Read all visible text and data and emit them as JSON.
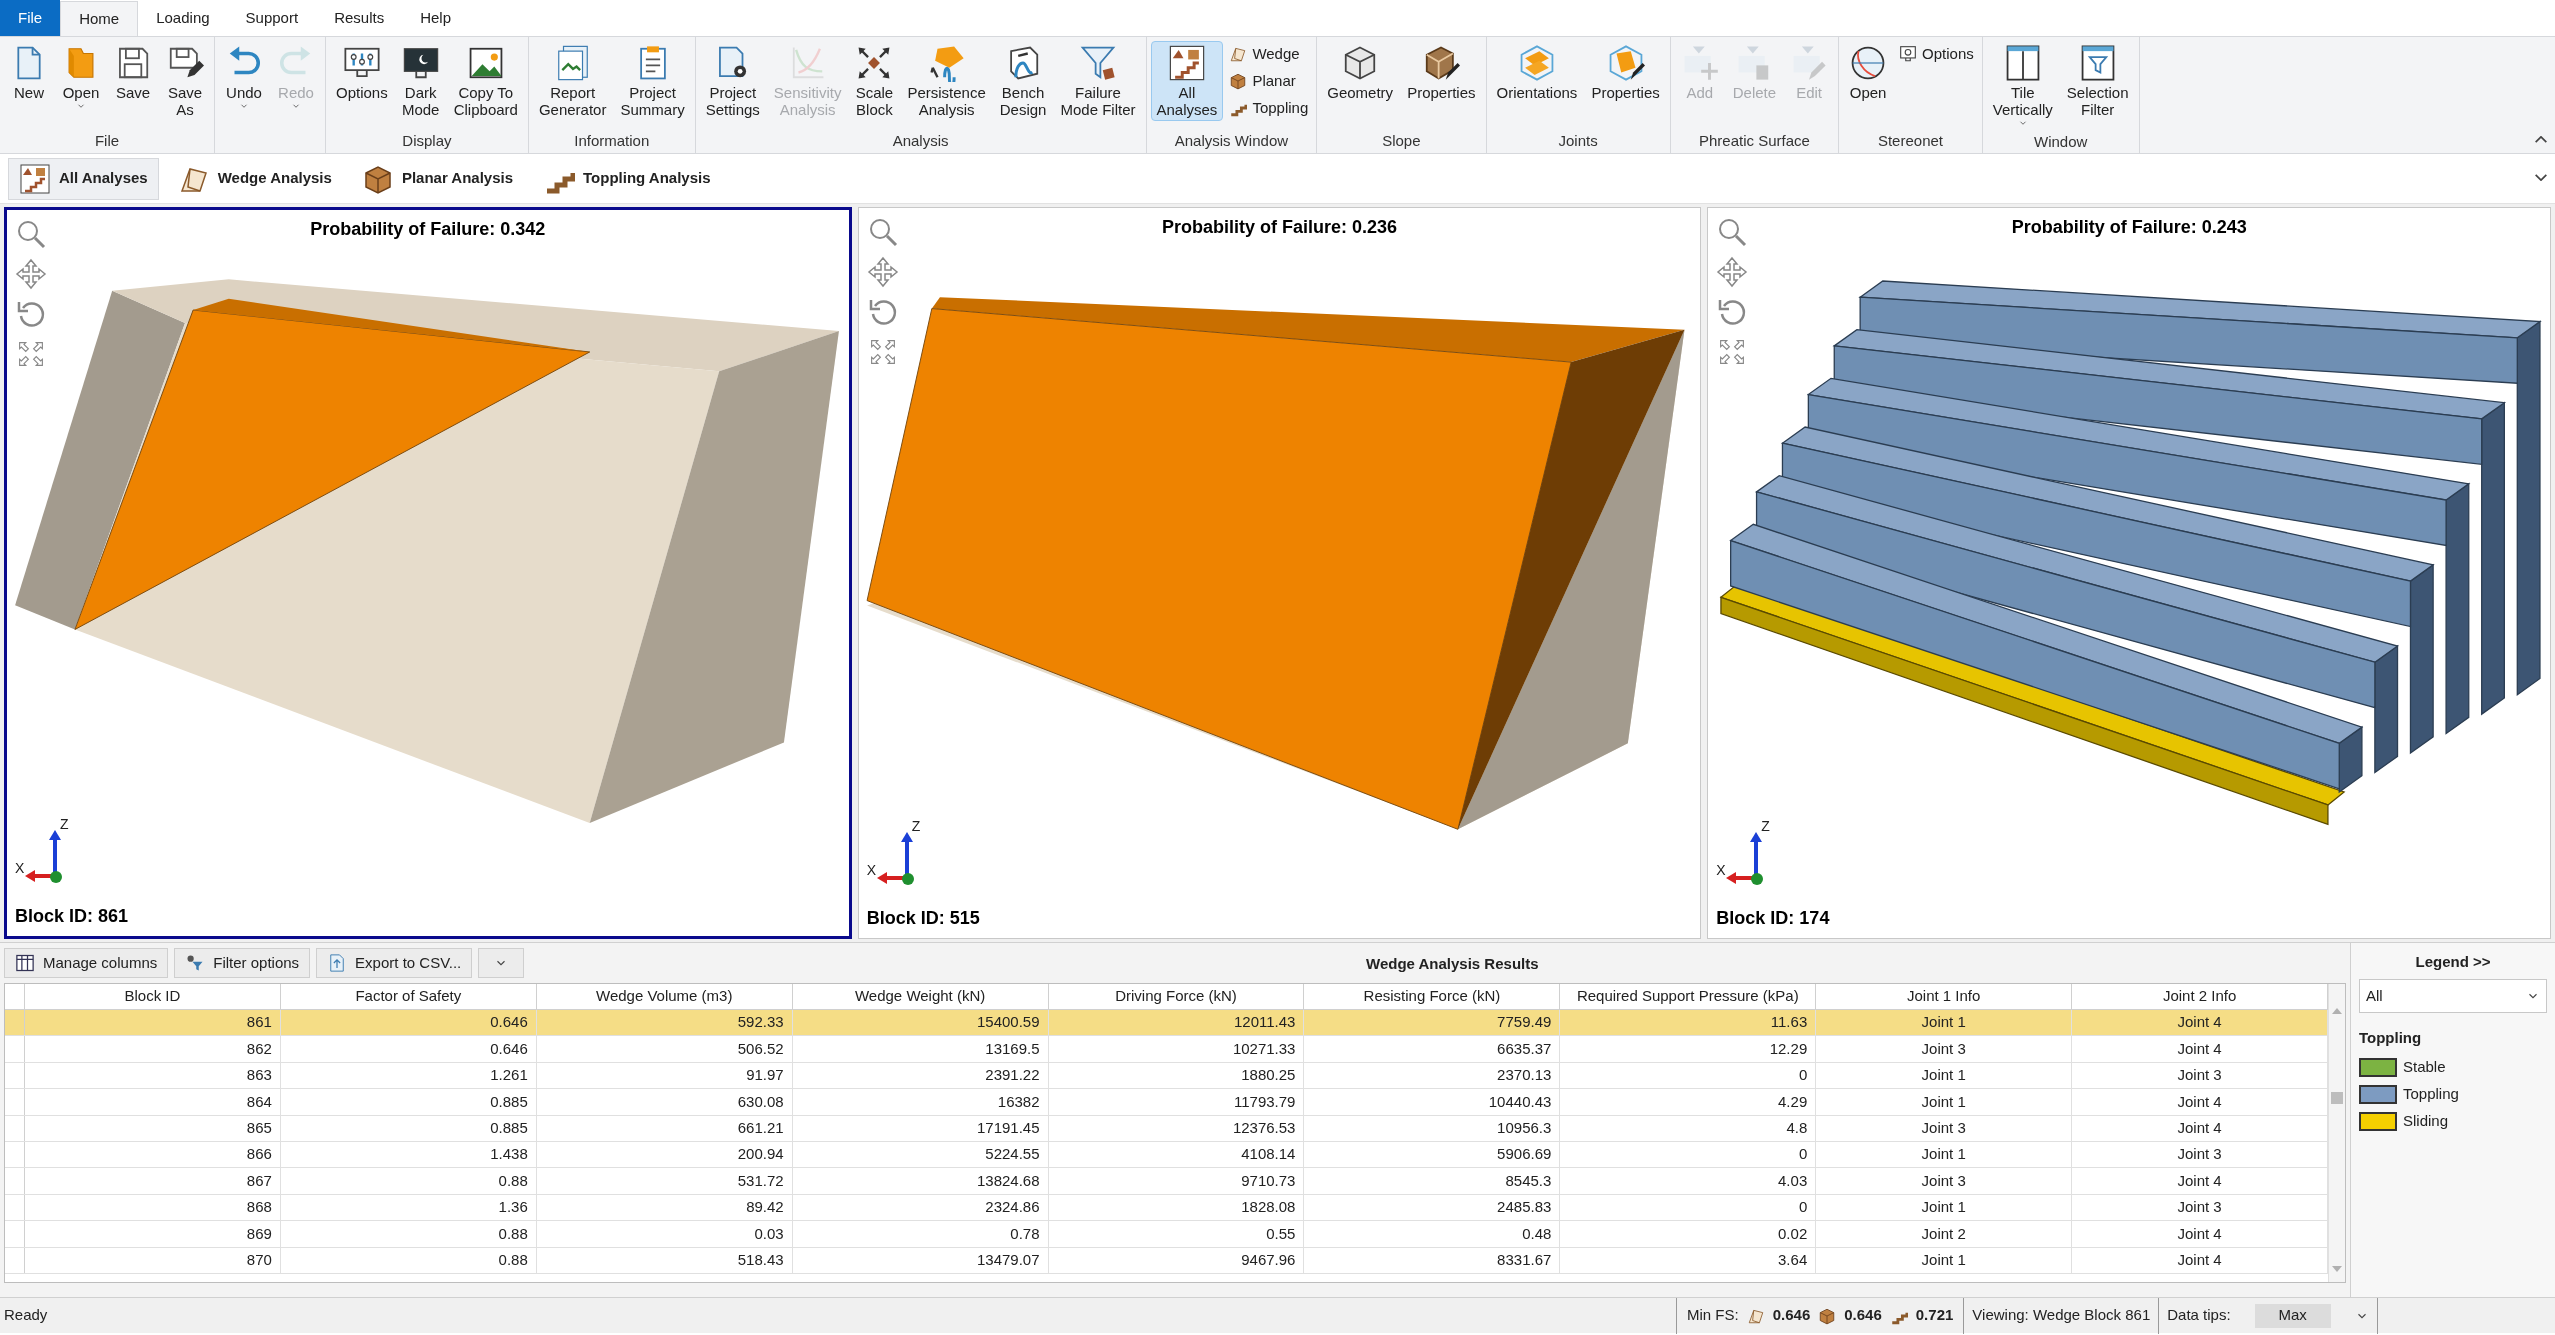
{
  "menu_tabs": [
    {
      "label": "File",
      "selected": false,
      "kind": "file"
    },
    {
      "label": "Home",
      "selected": true,
      "kind": "tab"
    },
    {
      "label": "Loading",
      "selected": false,
      "kind": "tab"
    },
    {
      "label": "Support",
      "selected": false,
      "kind": "tab"
    },
    {
      "label": "Results",
      "selected": false,
      "kind": "tab"
    },
    {
      "label": "Help",
      "selected": false,
      "kind": "tab"
    }
  ],
  "ribbon": [
    {
      "label": "File",
      "items": [
        {
          "label": "New",
          "kind": "large",
          "disabled": false,
          "dropdown": false,
          "selected": false
        },
        {
          "label": "Open",
          "kind": "large",
          "disabled": false,
          "dropdown": true,
          "selected": false
        },
        {
          "label": "Save",
          "kind": "large",
          "disabled": false,
          "dropdown": false,
          "selected": false
        },
        {
          "label": "Save\nAs",
          "kind": "large",
          "disabled": false,
          "dropdown": false,
          "selected": false
        }
      ]
    },
    {
      "items": [
        {
          "label": "Undo",
          "kind": "large",
          "disabled": false,
          "dropdown": true,
          "selected": false
        },
        {
          "label": "Redo",
          "kind": "large",
          "disabled": true,
          "dropdown": true,
          "selected": false
        }
      ]
    },
    {
      "label": "Display",
      "items": [
        {
          "label": "Options",
          "kind": "large",
          "disabled": false,
          "dropdown": false,
          "selected": false
        },
        {
          "label": "Dark\nMode",
          "kind": "large",
          "disabled": false,
          "dropdown": false,
          "selected": false
        },
        {
          "label": "Copy To\nClipboard",
          "kind": "large",
          "disabled": false,
          "dropdown": false,
          "selected": false
        }
      ]
    },
    {
      "label": "Information",
      "items": [
        {
          "label": "Report\nGenerator",
          "kind": "large",
          "disabled": false,
          "dropdown": false,
          "selected": false
        },
        {
          "label": "Project\nSummary",
          "kind": "large",
          "disabled": false,
          "dropdown": false,
          "selected": false
        }
      ]
    },
    {
      "label": "Analysis",
      "items": [
        {
          "label": "Project\nSettings",
          "kind": "large",
          "disabled": false,
          "dropdown": false,
          "selected": false
        },
        {
          "label": "Sensitivity\nAnalysis",
          "kind": "large",
          "disabled": true,
          "dropdown": false,
          "selected": false
        },
        {
          "label": "Scale\nBlock",
          "kind": "large",
          "disabled": false,
          "dropdown": false,
          "selected": false
        },
        {
          "label": "Persistence\nAnalysis",
          "kind": "large",
          "disabled": false,
          "dropdown": false,
          "selected": false
        },
        {
          "label": "Bench\nDesign",
          "kind": "large",
          "disabled": false,
          "dropdown": false,
          "selected": false
        },
        {
          "label": "Failure\nMode Filter",
          "kind": "large",
          "disabled": false,
          "dropdown": false,
          "selected": false
        }
      ]
    },
    {
      "label": "Analysis Window",
      "items": [
        {
          "label": "All\nAnalyses",
          "kind": "large",
          "disabled": false,
          "dropdown": false,
          "selected": true
        },
        {
          "label": "Wedge",
          "kind": "small",
          "disabled": false,
          "dropdown": false,
          "selected": false
        },
        {
          "label": "Planar",
          "kind": "small",
          "disabled": false,
          "dropdown": false,
          "selected": false
        },
        {
          "label": "Toppling",
          "kind": "small",
          "disabled": false,
          "dropdown": false,
          "selected": false
        }
      ]
    },
    {
      "label": "Slope",
      "items": [
        {
          "label": "Geometry",
          "kind": "large",
          "disabled": false,
          "dropdown": false,
          "selected": false
        },
        {
          "label": "Properties",
          "kind": "large",
          "disabled": false,
          "dropdown": false,
          "selected": false
        }
      ]
    },
    {
      "label": "Joints",
      "items": [
        {
          "label": "Orientations",
          "kind": "large",
          "disabled": false,
          "dropdown": false,
          "selected": false
        },
        {
          "label": "Properties",
          "kind": "large",
          "disabled": false,
          "dropdown": false,
          "selected": false
        }
      ]
    },
    {
      "label": "Phreatic Surface",
      "items": [
        {
          "label": "Add",
          "kind": "large",
          "disabled": true,
          "dropdown": false,
          "selected": false
        },
        {
          "label": "Delete",
          "kind": "large",
          "disabled": true,
          "dropdown": false,
          "selected": false
        },
        {
          "label": "Edit",
          "kind": "large",
          "disabled": true,
          "dropdown": false,
          "selected": false
        }
      ]
    },
    {
      "label": "Stereonet",
      "items": [
        {
          "label": "Open",
          "kind": "large",
          "disabled": false,
          "dropdown": false,
          "selected": false
        },
        {
          "label": "Options",
          "kind": "small",
          "disabled": false,
          "dropdown": false,
          "selected": false
        }
      ]
    },
    {
      "label": "Window",
      "items": [
        {
          "label": "Tile\nVertically",
          "kind": "large",
          "disabled": false,
          "dropdown": true,
          "selected": false
        },
        {
          "label": "Selection\nFilter",
          "kind": "large",
          "disabled": false,
          "dropdown": false,
          "selected": false
        }
      ]
    }
  ],
  "analysis_tabs": [
    {
      "label": "All Analyses",
      "selected": true
    },
    {
      "label": "Wedge Analysis",
      "selected": false
    },
    {
      "label": "Planar Analysis",
      "selected": false
    },
    {
      "label": "Toppling Analysis",
      "selected": false
    }
  ],
  "viewports": [
    {
      "kind": "wedge",
      "title": "Probability of Failure: 0.342",
      "block_id": "Block ID: 861",
      "selected": true,
      "axis_labels": [
        "Z",
        "X"
      ]
    },
    {
      "kind": "planar",
      "title": "Probability of Failure: 0.236",
      "block_id": "Block ID: 515",
      "selected": false,
      "axis_labels": [
        "Z",
        "X"
      ]
    },
    {
      "kind": "toppling",
      "title": "Probability of Failure: 0.243",
      "block_id": "Block ID: 174",
      "selected": false,
      "axis_labels": [
        "Z",
        "X"
      ]
    }
  ],
  "results": {
    "toolbar": [
      "Manage columns",
      "Filter options",
      "Export to CSV..."
    ],
    "title": "Wedge Analysis Results",
    "columns": [
      "Block ID",
      "Factor of Safety",
      "Wedge Volume (m3)",
      "Wedge Weight (kN)",
      "Driving Force (kN)",
      "Resisting Force (kN)",
      "Required Support Pressure (kPa)",
      "Joint 1 Info",
      "Joint 2 Info"
    ],
    "rows": [
      {
        "selected": true,
        "cells": [
          "861",
          "0.646",
          "592.33",
          "15400.59",
          "12011.43",
          "7759.49",
          "11.63",
          "Joint 1",
          "Joint 4"
        ]
      },
      {
        "selected": false,
        "cells": [
          "862",
          "0.646",
          "506.52",
          "13169.5",
          "10271.33",
          "6635.37",
          "12.29",
          "Joint 3",
          "Joint 4"
        ]
      },
      {
        "selected": false,
        "cells": [
          "863",
          "1.261",
          "91.97",
          "2391.22",
          "1880.25",
          "2370.13",
          "0",
          "Joint 1",
          "Joint 3"
        ]
      },
      {
        "selected": false,
        "cells": [
          "864",
          "0.885",
          "630.08",
          "16382",
          "11793.79",
          "10440.43",
          "4.29",
          "Joint 1",
          "Joint 4"
        ]
      },
      {
        "selected": false,
        "cells": [
          "865",
          "0.885",
          "661.21",
          "17191.45",
          "12376.53",
          "10956.3",
          "4.8",
          "Joint 3",
          "Joint 4"
        ]
      },
      {
        "selected": false,
        "cells": [
          "866",
          "1.438",
          "200.94",
          "5224.55",
          "4108.14",
          "5906.69",
          "0",
          "Joint 1",
          "Joint 3"
        ]
      },
      {
        "selected": false,
        "cells": [
          "867",
          "0.88",
          "531.72",
          "13824.68",
          "9710.73",
          "8545.3",
          "4.03",
          "Joint 3",
          "Joint 4"
        ]
      },
      {
        "selected": false,
        "cells": [
          "868",
          "1.36",
          "89.42",
          "2324.86",
          "1828.08",
          "2485.83",
          "0",
          "Joint 1",
          "Joint 3"
        ]
      },
      {
        "selected": false,
        "cells": [
          "869",
          "0.88",
          "0.03",
          "0.78",
          "0.55",
          "0.48",
          "0.02",
          "Joint 2",
          "Joint 4"
        ]
      },
      {
        "selected": false,
        "cells": [
          "870",
          "0.88",
          "518.43",
          "13479.07",
          "9467.96",
          "8331.67",
          "3.64",
          "Joint 1",
          "Joint 4"
        ]
      }
    ]
  },
  "legend": {
    "title": "Legend >>",
    "filter": "All",
    "section": "Toppling",
    "items": [
      {
        "label": "Stable",
        "color": "#7cb342"
      },
      {
        "label": "Toppling",
        "color": "#7d9bc1"
      },
      {
        "label": "Sliding",
        "color": "#f5d000"
      }
    ]
  },
  "status_bar": {
    "message": "Ready",
    "min_fs_label": "Min FS:",
    "min_fs": [
      "0.646",
      "0.646",
      "0.721"
    ],
    "viewing": "Viewing: Wedge Block 861",
    "data_tips_label": "Data tips:",
    "data_tips": "Max"
  }
}
